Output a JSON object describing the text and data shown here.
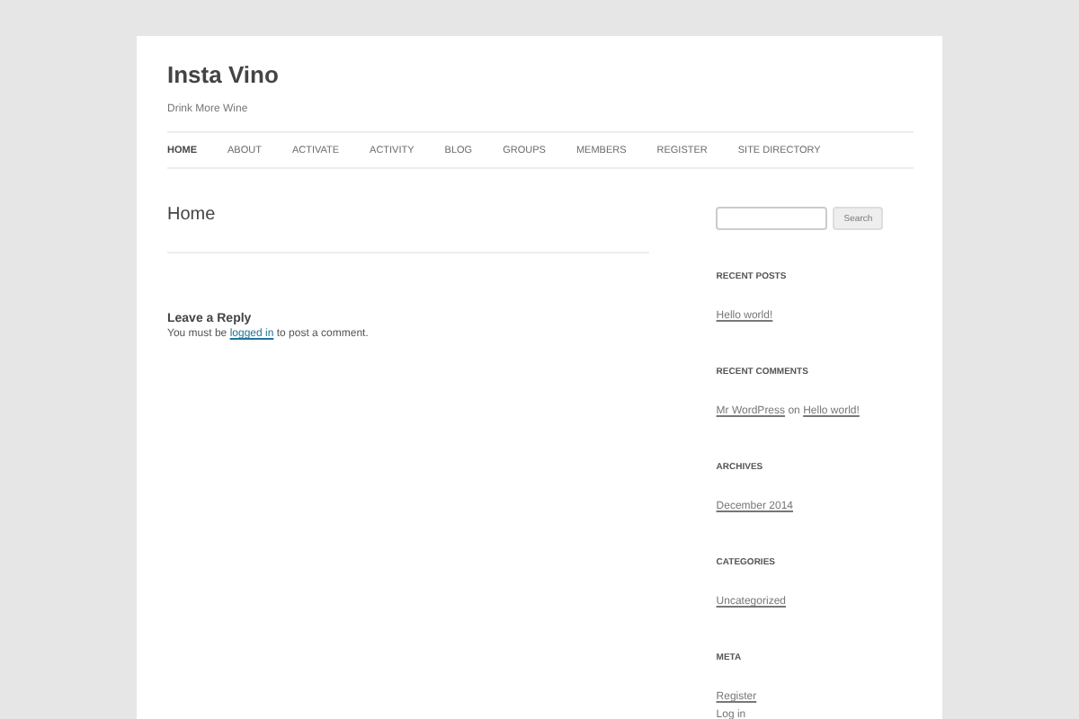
{
  "site": {
    "title": "Insta Vino",
    "tagline": "Drink More Wine"
  },
  "nav": [
    {
      "label": "HOME",
      "selected": true
    },
    {
      "label": "ABOUT",
      "selected": false
    },
    {
      "label": "ACTIVATE",
      "selected": false
    },
    {
      "label": "ACTIVITY",
      "selected": false
    },
    {
      "label": "BLOG",
      "selected": false
    },
    {
      "label": "GROUPS",
      "selected": false
    },
    {
      "label": "MEMBERS",
      "selected": false
    },
    {
      "label": "REGISTER",
      "selected": false
    },
    {
      "label": "SITE DIRECTORY",
      "selected": false
    }
  ],
  "main": {
    "page_title": "Home",
    "reply_heading": "Leave a Reply",
    "reply_note": {
      "before": "You must be",
      "link": "logged in",
      "after": "to post a comment."
    }
  },
  "sidebar": {
    "search": {
      "button": "Search"
    },
    "widgets": [
      {
        "title": "RECENT POSTS",
        "items": [
          {
            "kind": "link",
            "text": "Hello world!"
          }
        ]
      },
      {
        "title": "RECENT COMMENTS",
        "items": [
          {
            "kind": "comment",
            "author": "Mr WordPress",
            "joiner": "on",
            "post": "Hello world!"
          }
        ]
      },
      {
        "title": "ARCHIVES",
        "items": [
          {
            "kind": "link",
            "text": "December 2014"
          }
        ]
      },
      {
        "title": "CATEGORIES",
        "items": [
          {
            "kind": "link",
            "text": "Uncategorized"
          }
        ]
      },
      {
        "title": "META",
        "items": [
          {
            "kind": "link",
            "text": "Register"
          },
          {
            "kind": "link",
            "text": "Log in"
          }
        ]
      }
    ]
  }
}
